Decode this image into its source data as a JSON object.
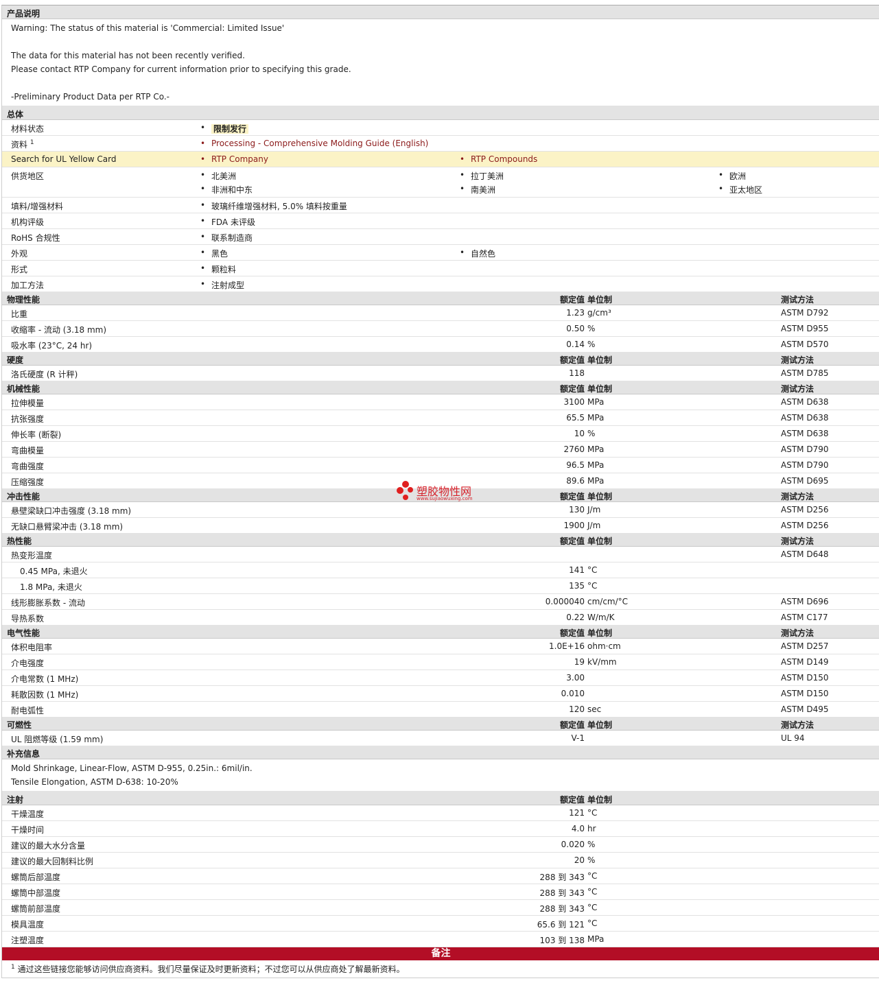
{
  "description": {
    "title": "产品说明",
    "lines": [
      "Warning: The status of this material is 'Commercial: Limited Issue'",
      "",
      "The data for this material has not been recently verified.",
      "Please contact RTP Company for current information prior to specifying this grade.",
      "",
      "-Preliminary Product Data per RTP Co.-"
    ]
  },
  "general": {
    "title": "总体",
    "status_label": "材料状态",
    "status_value": "限制发行",
    "info_label": "资料",
    "info_sup": "1",
    "info_link": "Processing - Comprehensive Molding Guide (English)",
    "ul_label": "Search for UL Yellow Card",
    "ul_link1": "RTP Company",
    "ul_link2": "RTP Compounds",
    "region_label": "供货地区",
    "regions": [
      "北美洲",
      "拉丁美洲",
      "欧洲",
      "非洲和中东",
      "南美洲",
      "亚太地区"
    ],
    "filler_label": "填料/增强材料",
    "filler_value": "玻璃纤维增强材料, 5.0% 填料按重量",
    "agency_label": "机构评级",
    "agency_value": "FDA 未评级",
    "rohs_label": "RoHS 合规性",
    "rohs_value": "联系制造商",
    "appearance_label": "外观",
    "appearance_values": [
      "黑色",
      "自然色"
    ],
    "form_label": "形式",
    "form_value": "颗粒料",
    "process_label": "加工方法",
    "process_value": "注射成型"
  },
  "col_headers": {
    "value": "额定值",
    "unit": "单位制",
    "method": "测试方法"
  },
  "sections": [
    {
      "title": "物理性能",
      "rows": [
        {
          "label": "比重",
          "value": "1.23",
          "unit": "g/cm³",
          "method": "ASTM D792"
        },
        {
          "label": "收缩率  - 流动  (3.18 mm)",
          "value": "0.50",
          "unit": "%",
          "method": "ASTM D955"
        },
        {
          "label": "吸水率  (23°C, 24 hr)",
          "value": "0.14",
          "unit": "%",
          "method": "ASTM D570"
        }
      ]
    },
    {
      "title": "硬度",
      "rows": [
        {
          "label": "洛氏硬度  (R 计秤)",
          "value": "118",
          "unit": "",
          "method": "ASTM D785"
        }
      ]
    },
    {
      "title": "机械性能",
      "rows": [
        {
          "label": "拉伸模量",
          "value": "3100",
          "unit": "MPa",
          "method": "ASTM D638"
        },
        {
          "label": "抗张强度",
          "value": "65.5",
          "unit": "MPa",
          "method": "ASTM D638"
        },
        {
          "label": "伸长率  (断裂)",
          "value": "10",
          "unit": "%",
          "method": "ASTM D638"
        },
        {
          "label": "弯曲模量",
          "value": "2760",
          "unit": "MPa",
          "method": "ASTM D790"
        },
        {
          "label": "弯曲强度",
          "value": "96.5",
          "unit": "MPa",
          "method": "ASTM D790"
        },
        {
          "label": "压缩强度",
          "value": "89.6",
          "unit": "MPa",
          "method": "ASTM D695"
        }
      ]
    },
    {
      "title": "冲击性能",
      "rows": [
        {
          "label": "悬壁梁缺口冲击强度  (3.18 mm)",
          "value": "130",
          "unit": "J/m",
          "method": "ASTM D256"
        },
        {
          "label": "无缺口悬臂梁冲击  (3.18 mm)",
          "value": "1900",
          "unit": "J/m",
          "method": "ASTM D256"
        }
      ]
    },
    {
      "title": "热性能",
      "rows": [
        {
          "label": "热变形温度",
          "value": "",
          "unit": "",
          "method": "ASTM D648"
        },
        {
          "label": "0.45 MPa, 未退火",
          "value": "141",
          "unit": "°C",
          "method": "",
          "indent": true
        },
        {
          "label": "1.8 MPa, 未退火",
          "value": "135",
          "unit": "°C",
          "method": "",
          "indent": true
        },
        {
          "label": "线形膨胀系数  - 流动",
          "value": "0.000040",
          "unit": "cm/cm/°C",
          "method": "ASTM D696"
        },
        {
          "label": "导热系数",
          "value": "0.22",
          "unit": "W/m/K",
          "method": "ASTM C177"
        }
      ]
    },
    {
      "title": "电气性能",
      "rows": [
        {
          "label": "体积电阻率",
          "value": "1.0E+16",
          "unit": "ohm·cm",
          "method": "ASTM D257"
        },
        {
          "label": "介电强度",
          "value": "19",
          "unit": "kV/mm",
          "method": "ASTM D149"
        },
        {
          "label": "介电常数  (1 MHz)",
          "value": "3.00",
          "unit": "",
          "method": "ASTM D150"
        },
        {
          "label": "耗散因数  (1 MHz)",
          "value": "0.010",
          "unit": "",
          "method": "ASTM D150"
        },
        {
          "label": "耐电弧性",
          "value": "120",
          "unit": "sec",
          "method": "ASTM D495"
        }
      ]
    },
    {
      "title": "可燃性",
      "rows": [
        {
          "label": "UL 阻燃等级  (1.59 mm)",
          "value": "V-1",
          "unit": "",
          "method": "UL 94"
        }
      ]
    }
  ],
  "supplemental": {
    "title": "补充信息",
    "lines": [
      "Mold Shrinkage, Linear-Flow, ASTM D-955, 0.25in.: 6mil/in.",
      "Tensile Elongation, ASTM D-638: 10-20%"
    ]
  },
  "injection": {
    "title": "注射",
    "rows": [
      {
        "label": "干燥温度",
        "value": "121",
        "unit": "°C"
      },
      {
        "label": "干燥时间",
        "value": "4.0",
        "unit": "hr"
      },
      {
        "label": "建议的最大水分含量",
        "value": "0.020",
        "unit": "%"
      },
      {
        "label": "建议的最大回制料比例",
        "value": "20",
        "unit": "%"
      },
      {
        "label": "螺筒后部温度",
        "value": "288 到  343",
        "unit": "°C"
      },
      {
        "label": "螺筒中部温度",
        "value": "288 到  343",
        "unit": "°C"
      },
      {
        "label": "螺筒前部温度",
        "value": "288 到  343",
        "unit": "°C"
      },
      {
        "label": "模具温度",
        "value": "65.6 到  121",
        "unit": "°C"
      },
      {
        "label": "注塑温度",
        "value": "103 到  138",
        "unit": "MPa"
      }
    ]
  },
  "notes": {
    "title": "备注",
    "footnote_sup": "1",
    "footnote": "通过这些链接您能够访问供应商资料。我们尽量保证及时更新资料；不过您可以从供应商处了解最新资料。"
  },
  "watermark": {
    "name": "塑胶物性网",
    "url": "www.sujiaowuxing.com"
  }
}
